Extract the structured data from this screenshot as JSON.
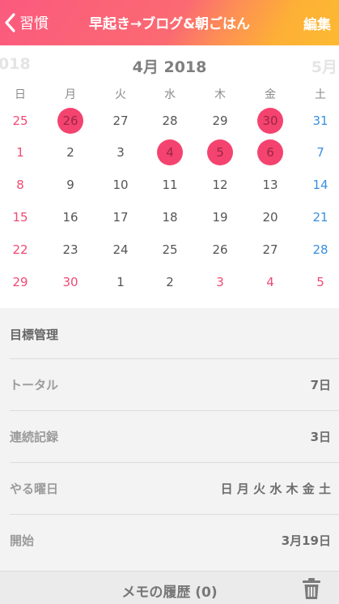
{
  "header": {
    "back_label": "習慣",
    "title": "早起き→ブログ&朝ごはん",
    "edit_label": "編集"
  },
  "calendar": {
    "prev_month_label": "018",
    "month_label": "4月 2018",
    "next_month_label": "5月",
    "weekdays": [
      "日",
      "月",
      "火",
      "水",
      "木",
      "金",
      "土"
    ],
    "weeks": [
      [
        "25",
        "26",
        "27",
        "28",
        "29",
        "30",
        "31"
      ],
      [
        "1",
        "2",
        "3",
        "4",
        "5",
        "6",
        "7"
      ],
      [
        "8",
        "9",
        "10",
        "11",
        "12",
        "13",
        "14"
      ],
      [
        "15",
        "16",
        "17",
        "18",
        "19",
        "20",
        "21"
      ],
      [
        "22",
        "23",
        "24",
        "25",
        "26",
        "27",
        "28"
      ],
      [
        "29",
        "30",
        "1",
        "2",
        "3",
        "4",
        "5"
      ]
    ],
    "completed_days": [
      "26 (March)",
      "30 (March)",
      "4",
      "5",
      "6"
    ]
  },
  "stats": {
    "title": "目標管理",
    "rows": [
      {
        "label": "トータル",
        "value": "7日"
      },
      {
        "label": "連続記録",
        "value": "3日"
      },
      {
        "label": "やる曜日",
        "value": "日 月 火 水 木 金 土"
      },
      {
        "label": "開始",
        "value": "3月19日"
      }
    ]
  },
  "footer": {
    "memo_label": "メモの履歴 (0)",
    "trash_icon": "trash-icon"
  },
  "colors": {
    "header_start": "#fb5a7e",
    "header_end": "#fdb932",
    "completed": "#f4436f",
    "sunday": "#f04a73",
    "saturday": "#3a8fe0"
  }
}
